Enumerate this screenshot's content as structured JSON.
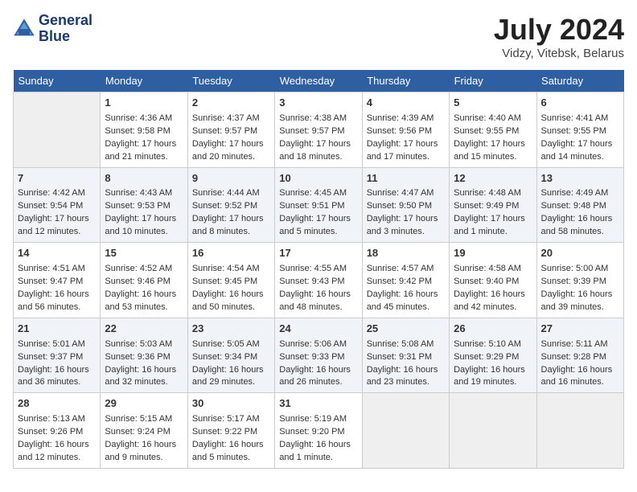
{
  "header": {
    "logo_line1": "General",
    "logo_line2": "Blue",
    "month": "July 2024",
    "location": "Vidzy, Vitebsk, Belarus"
  },
  "days_of_week": [
    "Sunday",
    "Monday",
    "Tuesday",
    "Wednesday",
    "Thursday",
    "Friday",
    "Saturday"
  ],
  "weeks": [
    [
      {
        "day": "",
        "empty": true
      },
      {
        "day": "1",
        "sunrise": "Sunrise: 4:36 AM",
        "sunset": "Sunset: 9:58 PM",
        "daylight": "Daylight: 17 hours and 21 minutes."
      },
      {
        "day": "2",
        "sunrise": "Sunrise: 4:37 AM",
        "sunset": "Sunset: 9:57 PM",
        "daylight": "Daylight: 17 hours and 20 minutes."
      },
      {
        "day": "3",
        "sunrise": "Sunrise: 4:38 AM",
        "sunset": "Sunset: 9:57 PM",
        "daylight": "Daylight: 17 hours and 18 minutes."
      },
      {
        "day": "4",
        "sunrise": "Sunrise: 4:39 AM",
        "sunset": "Sunset: 9:56 PM",
        "daylight": "Daylight: 17 hours and 17 minutes."
      },
      {
        "day": "5",
        "sunrise": "Sunrise: 4:40 AM",
        "sunset": "Sunset: 9:55 PM",
        "daylight": "Daylight: 17 hours and 15 minutes."
      },
      {
        "day": "6",
        "sunrise": "Sunrise: 4:41 AM",
        "sunset": "Sunset: 9:55 PM",
        "daylight": "Daylight: 17 hours and 14 minutes."
      }
    ],
    [
      {
        "day": "7",
        "sunrise": "Sunrise: 4:42 AM",
        "sunset": "Sunset: 9:54 PM",
        "daylight": "Daylight: 17 hours and 12 minutes."
      },
      {
        "day": "8",
        "sunrise": "Sunrise: 4:43 AM",
        "sunset": "Sunset: 9:53 PM",
        "daylight": "Daylight: 17 hours and 10 minutes."
      },
      {
        "day": "9",
        "sunrise": "Sunrise: 4:44 AM",
        "sunset": "Sunset: 9:52 PM",
        "daylight": "Daylight: 17 hours and 8 minutes."
      },
      {
        "day": "10",
        "sunrise": "Sunrise: 4:45 AM",
        "sunset": "Sunset: 9:51 PM",
        "daylight": "Daylight: 17 hours and 5 minutes."
      },
      {
        "day": "11",
        "sunrise": "Sunrise: 4:47 AM",
        "sunset": "Sunset: 9:50 PM",
        "daylight": "Daylight: 17 hours and 3 minutes."
      },
      {
        "day": "12",
        "sunrise": "Sunrise: 4:48 AM",
        "sunset": "Sunset: 9:49 PM",
        "daylight": "Daylight: 17 hours and 1 minute."
      },
      {
        "day": "13",
        "sunrise": "Sunrise: 4:49 AM",
        "sunset": "Sunset: 9:48 PM",
        "daylight": "Daylight: 16 hours and 58 minutes."
      }
    ],
    [
      {
        "day": "14",
        "sunrise": "Sunrise: 4:51 AM",
        "sunset": "Sunset: 9:47 PM",
        "daylight": "Daylight: 16 hours and 56 minutes."
      },
      {
        "day": "15",
        "sunrise": "Sunrise: 4:52 AM",
        "sunset": "Sunset: 9:46 PM",
        "daylight": "Daylight: 16 hours and 53 minutes."
      },
      {
        "day": "16",
        "sunrise": "Sunrise: 4:54 AM",
        "sunset": "Sunset: 9:45 PM",
        "daylight": "Daylight: 16 hours and 50 minutes."
      },
      {
        "day": "17",
        "sunrise": "Sunrise: 4:55 AM",
        "sunset": "Sunset: 9:43 PM",
        "daylight": "Daylight: 16 hours and 48 minutes."
      },
      {
        "day": "18",
        "sunrise": "Sunrise: 4:57 AM",
        "sunset": "Sunset: 9:42 PM",
        "daylight": "Daylight: 16 hours and 45 minutes."
      },
      {
        "day": "19",
        "sunrise": "Sunrise: 4:58 AM",
        "sunset": "Sunset: 9:40 PM",
        "daylight": "Daylight: 16 hours and 42 minutes."
      },
      {
        "day": "20",
        "sunrise": "Sunrise: 5:00 AM",
        "sunset": "Sunset: 9:39 PM",
        "daylight": "Daylight: 16 hours and 39 minutes."
      }
    ],
    [
      {
        "day": "21",
        "sunrise": "Sunrise: 5:01 AM",
        "sunset": "Sunset: 9:37 PM",
        "daylight": "Daylight: 16 hours and 36 minutes."
      },
      {
        "day": "22",
        "sunrise": "Sunrise: 5:03 AM",
        "sunset": "Sunset: 9:36 PM",
        "daylight": "Daylight: 16 hours and 32 minutes."
      },
      {
        "day": "23",
        "sunrise": "Sunrise: 5:05 AM",
        "sunset": "Sunset: 9:34 PM",
        "daylight": "Daylight: 16 hours and 29 minutes."
      },
      {
        "day": "24",
        "sunrise": "Sunrise: 5:06 AM",
        "sunset": "Sunset: 9:33 PM",
        "daylight": "Daylight: 16 hours and 26 minutes."
      },
      {
        "day": "25",
        "sunrise": "Sunrise: 5:08 AM",
        "sunset": "Sunset: 9:31 PM",
        "daylight": "Daylight: 16 hours and 23 minutes."
      },
      {
        "day": "26",
        "sunrise": "Sunrise: 5:10 AM",
        "sunset": "Sunset: 9:29 PM",
        "daylight": "Daylight: 16 hours and 19 minutes."
      },
      {
        "day": "27",
        "sunrise": "Sunrise: 5:11 AM",
        "sunset": "Sunset: 9:28 PM",
        "daylight": "Daylight: 16 hours and 16 minutes."
      }
    ],
    [
      {
        "day": "28",
        "sunrise": "Sunrise: 5:13 AM",
        "sunset": "Sunset: 9:26 PM",
        "daylight": "Daylight: 16 hours and 12 minutes."
      },
      {
        "day": "29",
        "sunrise": "Sunrise: 5:15 AM",
        "sunset": "Sunset: 9:24 PM",
        "daylight": "Daylight: 16 hours and 9 minutes."
      },
      {
        "day": "30",
        "sunrise": "Sunrise: 5:17 AM",
        "sunset": "Sunset: 9:22 PM",
        "daylight": "Daylight: 16 hours and 5 minutes."
      },
      {
        "day": "31",
        "sunrise": "Sunrise: 5:19 AM",
        "sunset": "Sunset: 9:20 PM",
        "daylight": "Daylight: 16 hours and 1 minute."
      },
      {
        "day": "",
        "empty": true
      },
      {
        "day": "",
        "empty": true
      },
      {
        "day": "",
        "empty": true
      }
    ]
  ]
}
